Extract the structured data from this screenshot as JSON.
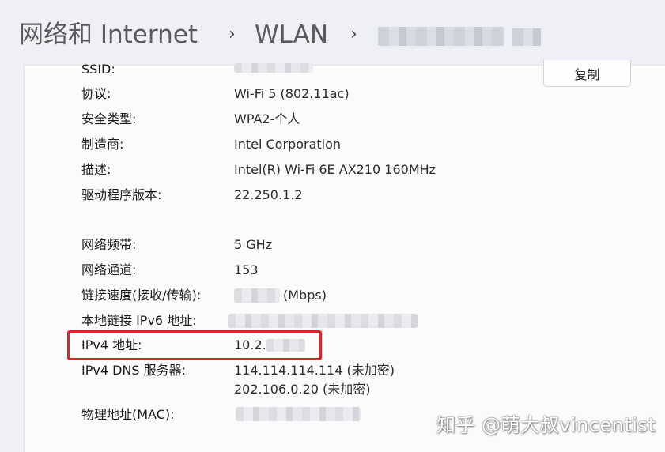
{
  "breadcrumb": {
    "level1": "网络和 Internet",
    "level2": "WLAN",
    "separator": "›"
  },
  "copy_button": {
    "label": "复制"
  },
  "properties": [
    {
      "label": "SSID:",
      "value": ""
    },
    {
      "label": "协议:",
      "value": "Wi-Fi 5 (802.11ac)"
    },
    {
      "label": "安全类型:",
      "value": "WPA2-个人"
    },
    {
      "label": "制造商:",
      "value": "Intel Corporation"
    },
    {
      "label": "描述:",
      "value": "Intel(R) Wi-Fi 6E AX210 160MHz"
    },
    {
      "label": "驱动程序版本:",
      "value": "22.250.1.2"
    },
    {
      "label": "网络频带:",
      "value": "5 GHz"
    },
    {
      "label": "网络通道:",
      "value": "153"
    },
    {
      "label": "链接速度(接收/传输):",
      "value": "(Mbps)"
    },
    {
      "label": "本地链接 IPv6 地址:",
      "value": ""
    },
    {
      "label": "IPv4 地址:",
      "value": "10.2.2"
    },
    {
      "label": "IPv4 DNS 服务器:",
      "value": "114.114.114.114 (未加密)",
      "value2": "202.106.0.20 (未加密)"
    },
    {
      "label": "物理地址(MAC):",
      "value": ""
    }
  ],
  "watermark": "知乎 @萌大叔vincentist",
  "colors": {
    "highlight": "#e02424",
    "background": "#eef0f6",
    "card": "#fbfbfc"
  }
}
